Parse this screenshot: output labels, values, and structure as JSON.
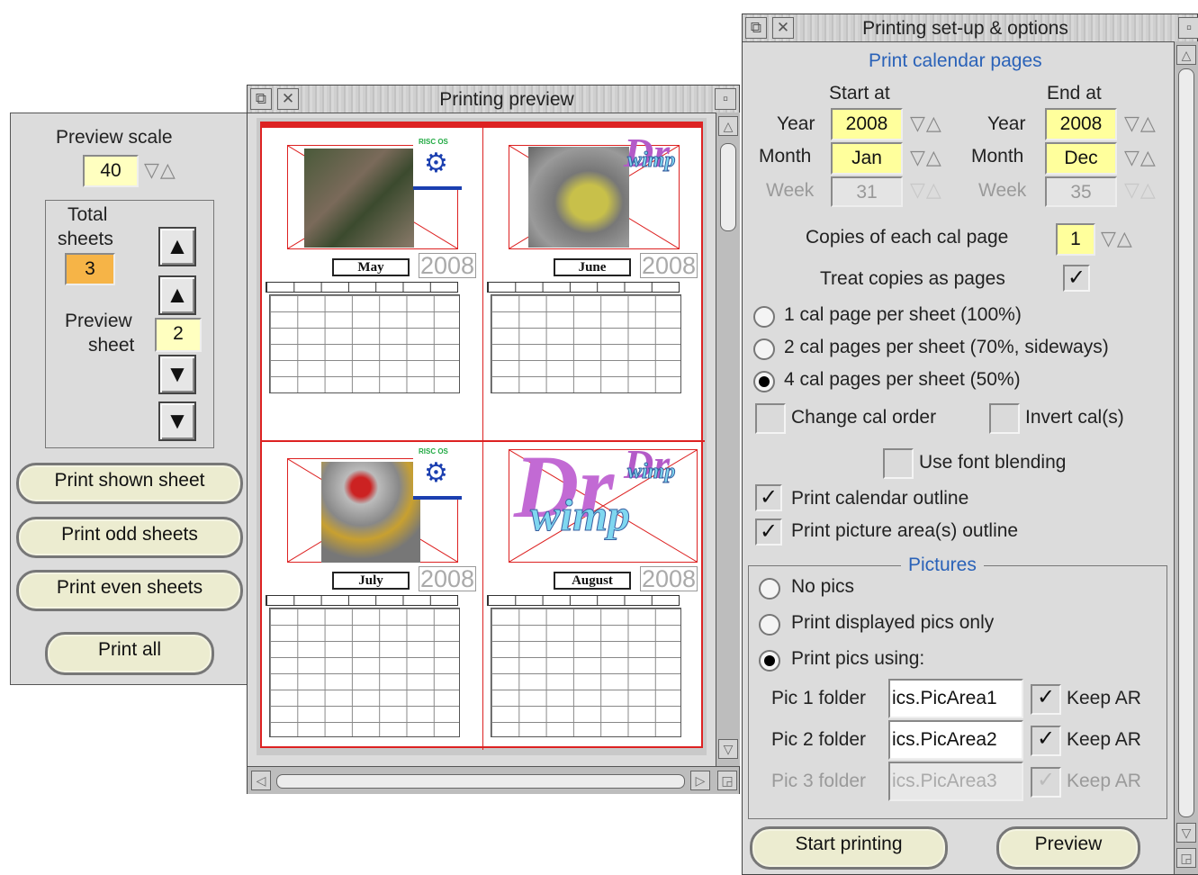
{
  "left_panel": {
    "preview_scale_label": "Preview scale",
    "preview_scale_value": "40",
    "total_sheets_label_1": "Total",
    "total_sheets_label_2": "sheets",
    "total_sheets_value": "3",
    "preview_sheet_label_1": "Preview",
    "preview_sheet_label_2": "sheet",
    "preview_sheet_value": "2",
    "buttons": {
      "print_shown": "Print shown sheet",
      "print_odd": "Print odd sheets",
      "print_even": "Print even sheets",
      "print_all": "Print all"
    }
  },
  "preview_window": {
    "title": "Printing preview",
    "pages": [
      {
        "month": "May",
        "year": "2008"
      },
      {
        "month": "June",
        "year": "2008"
      },
      {
        "month": "July",
        "year": "2008"
      },
      {
        "month": "August",
        "year": "2008"
      }
    ],
    "logo_text": "RISC OS",
    "drwimp_1": "Dr",
    "drwimp_2": "wimp"
  },
  "setup_window": {
    "title": "Printing set-up & options",
    "section_title": "Print calendar pages",
    "start_at": "Start at",
    "end_at": "End at",
    "year_label": "Year",
    "month_label": "Month",
    "week_label": "Week",
    "start_year": "2008",
    "start_month": "Jan",
    "start_week": "31",
    "end_year": "2008",
    "end_month": "Dec",
    "end_week": "35",
    "copies_label": "Copies of each cal page",
    "copies_value": "1",
    "treat_copies_label": "Treat copies as pages",
    "layout_options": [
      "1 cal page per sheet (100%)",
      "2 cal pages per sheet (70%, sideways)",
      "4 cal pages per sheet (50%)"
    ],
    "change_order_label": "Change cal order",
    "invert_label": "Invert cal(s)",
    "font_blending_label": "Use font blending",
    "print_outline_label": "Print calendar outline",
    "print_pic_outline_label": "Print picture area(s) outline",
    "pictures_title": "Pictures",
    "pic_options": [
      "No pics",
      "Print displayed pics only",
      "Print pics using:"
    ],
    "pic1_label": "Pic 1 folder",
    "pic1_value": "ics.PicArea1",
    "pic2_label": "Pic 2 folder",
    "pic2_value": "ics.PicArea2",
    "pic3_label": "Pic 3 folder",
    "pic3_value": "ics.PicArea3",
    "keep_ar": "Keep AR",
    "start_button": "Start printing",
    "preview_button": "Preview"
  }
}
